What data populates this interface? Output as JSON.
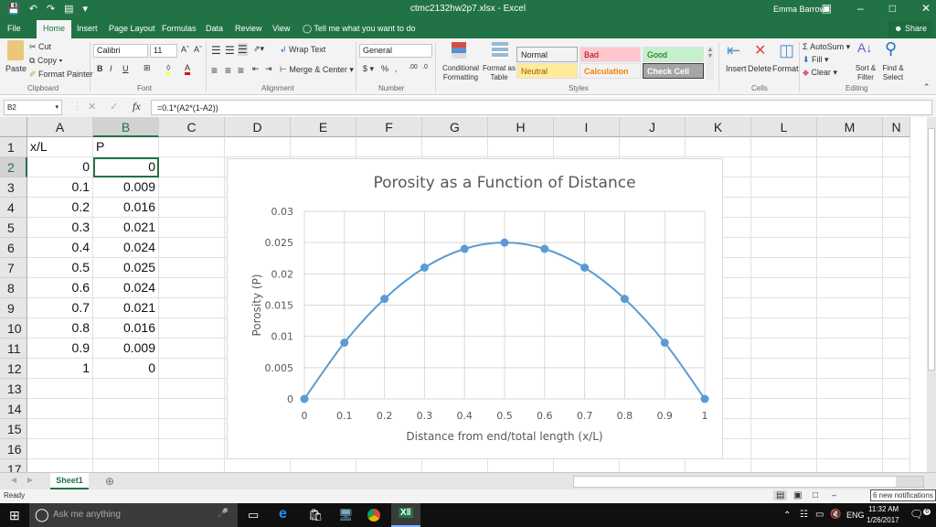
{
  "window": {
    "title": "ctmc2132hw2p7.xlsx - Excel",
    "user": "Emma Barrow",
    "qat": [
      "save-icon",
      "undo-icon",
      "redo-icon",
      "print-preview-icon",
      "form-icon",
      "customize-icon"
    ]
  },
  "tabs": [
    "File",
    "Home",
    "Insert",
    "Page Layout",
    "Formulas",
    "Data",
    "Review",
    "View"
  ],
  "tell_me": "Tell me what you want to do",
  "share": "Share",
  "ribbon": {
    "clipboard": {
      "label": "Clipboard",
      "paste": "Paste",
      "cut": "Cut",
      "copy": "Copy",
      "format_painter": "Format Painter"
    },
    "font": {
      "label": "Font",
      "name": "Calibri",
      "size": "11",
      "bold": "B",
      "italic": "I",
      "underline": "U"
    },
    "alignment": {
      "label": "Alignment",
      "wrap": "Wrap Text",
      "merge": "Merge & Center"
    },
    "number": {
      "label": "Number",
      "format": "General",
      "currency": "$",
      "percent": "%",
      "comma": ","
    },
    "styles": {
      "label": "Styles",
      "conditional": "Conditional Formatting",
      "format_table": "Format as Table",
      "cells": [
        {
          "name": "Normal",
          "bg": "#ffffff",
          "fg": "#000000"
        },
        {
          "name": "Bad",
          "bg": "#ffc7ce",
          "fg": "#9c0006"
        },
        {
          "name": "Good",
          "bg": "#c6efce",
          "fg": "#006100"
        },
        {
          "name": "Neutral",
          "bg": "#ffeb9c",
          "fg": "#9c5700"
        },
        {
          "name": "Calculation",
          "bg": "#f2f2f2",
          "fg": "#fa7d00"
        },
        {
          "name": "Check Cell",
          "bg": "#a5a5a5",
          "fg": "#ffffff"
        }
      ]
    },
    "cells": {
      "label": "Cells",
      "insert": "Insert",
      "delete": "Delete",
      "format": "Format"
    },
    "editing": {
      "label": "Editing",
      "autosum": "AutoSum",
      "fill": "Fill",
      "clear": "Clear",
      "sort": "Sort & Filter",
      "find": "Find & Select"
    }
  },
  "formula_bar": {
    "name_box": "B2",
    "formula": "=0.1*(A2*(1-A2))"
  },
  "columns": [
    "A",
    "B",
    "C",
    "D",
    "E",
    "F",
    "G",
    "H",
    "I",
    "J",
    "K",
    "L",
    "M",
    "N"
  ],
  "rows": [
    "1",
    "2",
    "3",
    "4",
    "5",
    "6",
    "7",
    "8",
    "9",
    "10",
    "11",
    "12",
    "13",
    "14",
    "15",
    "16",
    "17"
  ],
  "sheet": {
    "A": [
      "x/L",
      "0",
      "0.1",
      "0.2",
      "0.3",
      "0.4",
      "0.5",
      "0.6",
      "0.7",
      "0.8",
      "0.9",
      "1"
    ],
    "B": [
      "P",
      "0",
      "0.009",
      "0.016",
      "0.021",
      "0.024",
      "0.025",
      "0.024",
      "0.021",
      "0.016",
      "0.009",
      "0"
    ]
  },
  "selected_cell": "B2",
  "chart_data": {
    "type": "scatter",
    "title": "Porosity as a Function of Distance",
    "xlabel": "Distance from end/total length (x/L)",
    "ylabel": "Porosity (P)",
    "x": [
      0,
      0.1,
      0.2,
      0.3,
      0.4,
      0.5,
      0.6,
      0.7,
      0.8,
      0.9,
      1
    ],
    "y": [
      0,
      0.009,
      0.016,
      0.021,
      0.024,
      0.025,
      0.024,
      0.021,
      0.016,
      0.009,
      0
    ],
    "xlim": [
      0,
      1
    ],
    "ylim": [
      0,
      0.03
    ],
    "xticks": [
      "0",
      "0.1",
      "0.2",
      "0.3",
      "0.4",
      "0.5",
      "0.6",
      "0.7",
      "0.8",
      "0.9",
      "1"
    ],
    "yticks": [
      "0",
      "0.005",
      "0.01",
      "0.015",
      "0.02",
      "0.025",
      "0.03"
    ],
    "grid": true,
    "smooth": true,
    "markers": true,
    "color": "#5b9bd5"
  },
  "sheet_tabs": [
    "Sheet1"
  ],
  "status": {
    "ready": "Ready",
    "notification_tip": "6 new notifications"
  },
  "taskbar": {
    "search": "Ask me anything",
    "time": "11:32 AM",
    "date": "1/26/2017",
    "lang": "ENG",
    "notif_count": "6"
  }
}
